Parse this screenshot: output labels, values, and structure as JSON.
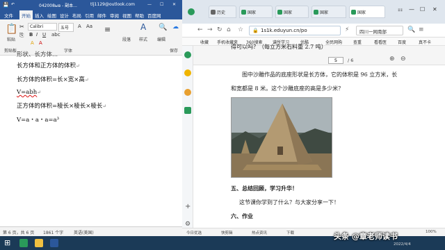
{
  "word": {
    "title": {
      "filename": "042008ыв - 副本...",
      "email": "tlj1129@outlook.com",
      "ctl_min": "—",
      "ctl_max": "☐",
      "ctl_close": "✕"
    },
    "tabs": [
      "文件",
      "开始",
      "插入",
      "绘图",
      "设计",
      "布局",
      "引用",
      "邮件",
      "审阅",
      "视图",
      "帮助",
      "百度网"
    ],
    "ribbon": {
      "font_name": "Calibri",
      "font_size": "五号",
      "paste_label": "粘贴",
      "clipboard_label": "剪贴板",
      "font_label": "字体",
      "paragraph_label": "段落",
      "style_label": "样式",
      "editing_label": "编辑",
      "save_to_baidu_label": "保存到百度网盘",
      "baidu_group_label": "保存"
    },
    "doc_lines": [
      "长方体和正方体的体积",
      "长方体的体积=长×宽×高",
      "V=abh",
      "正方体的体积=棱长×棱长×棱长",
      "V=a・a・a=a³"
    ],
    "top_partial_line": "形状、长方体...",
    "para_mark": "↵",
    "status": {
      "page": "第 6 页，共 6 页",
      "words": "1861 个字",
      "lang": "英语(美国)"
    }
  },
  "browser": {
    "tabs": [
      "历史",
      "国家",
      "国家",
      "国家",
      "国家"
    ],
    "win_ctl": [
      "⚏",
      "—",
      "☐",
      "✕"
    ],
    "url": "1s1k.eduyun.cn/po",
    "search_text": "四川一网南部",
    "bookmarks": [
      "收藏",
      "手机收藏夹",
      "360搜索",
      "谱所学习",
      "优酷",
      "全民网购",
      "查重",
      "看看医",
      "百度",
      "真不卡"
    ],
    "pdf": {
      "page_current": "5",
      "page_total": "/ 6",
      "zoom_in": "⊕",
      "zoom_out": "⊖"
    },
    "content": {
      "line_top": "得可以吗？（每立方米石料重 2.7 吨）",
      "q_line1": "图中沙雕作品的底座形状是长方体，它的体积是 96 立方米，长",
      "q_line2": "和宽都是 8 米。这个沙雕底座的高是多少米？",
      "section5": "五、总结回顾，学习升华！",
      "section5_body": "这节课你学到了什么？与大家分享一下！",
      "section6": "六、作业"
    },
    "status": [
      "今日优选",
      "快剪辑",
      "热点资讯",
      "下载",
      "100%"
    ]
  },
  "taskbar": {
    "watermark": "头条 @章老师读书",
    "date": "2022/4/4"
  },
  "colors": {
    "word_blue": "#2b579a",
    "taskbar": "#1b3a57",
    "browser_green": "#2a9a5a"
  }
}
